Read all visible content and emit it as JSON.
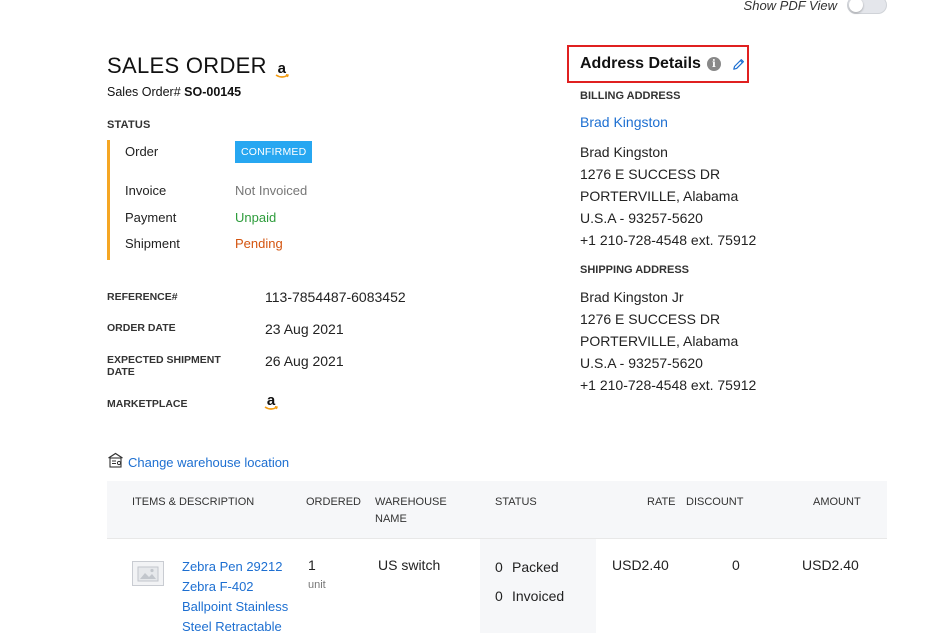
{
  "top": {
    "pdf_view_label": "Show PDF View"
  },
  "header": {
    "title": "SALES ORDER",
    "marketplace_logo_text": "a",
    "so_label": "Sales Order#",
    "so_number": "SO-00145"
  },
  "status": {
    "title": "STATUS",
    "rows": [
      {
        "label": "Order",
        "value": "CONFIRMED"
      },
      {
        "label": "Invoice",
        "value": "Not Invoiced"
      },
      {
        "label": "Payment",
        "value": "Unpaid"
      },
      {
        "label": "Shipment",
        "value": "Pending"
      }
    ],
    "colors": {
      "border": "#f5a623",
      "confirmed": "#27a7f1",
      "unpaid": "#2d9c3b",
      "pending": "#d4540f"
    }
  },
  "meta": {
    "reference_label": "REFERENCE#",
    "reference_value": "113-7854487-6083452",
    "order_date_label": "ORDER DATE",
    "order_date_value": "23 Aug 2021",
    "expected_shipment_label": "EXPECTED SHIPMENT DATE",
    "expected_shipment_value": "26 Aug 2021",
    "marketplace_label": "MARKETPLACE",
    "marketplace_icon": "amazon-logo"
  },
  "address": {
    "header_title": "Address Details",
    "billing_label": "BILLING ADDRESS",
    "billing_contact_link": "Brad Kingston",
    "billing_lines": [
      "Brad Kingston",
      "1276 E SUCCESS DR",
      "PORTERVILLE, Alabama",
      "U.S.A - 93257-5620",
      "+1 210-728-4548 ext. 75912"
    ],
    "shipping_label": "SHIPPING ADDRESS",
    "shipping_lines": [
      "Brad Kingston Jr",
      "1276 E SUCCESS DR",
      "PORTERVILLE, Alabama",
      "U.S.A - 93257-5620",
      "+1 210-728-4548 ext. 75912"
    ],
    "highlight_color": "#e02020"
  },
  "warehouse": {
    "link_text": "Change warehouse location"
  },
  "table": {
    "headers": {
      "items": "ITEMS & DESCRIPTION",
      "ordered": "ORDERED",
      "warehouse_l1": "WAREHOUSE",
      "warehouse_l2": "NAME",
      "status": "STATUS",
      "rate": "RATE",
      "discount": "DISCOUNT",
      "amount": "AMOUNT"
    },
    "rows": [
      {
        "item_lines": [
          "Zebra Pen 29212",
          "Zebra F-402",
          "Ballpoint Stainless",
          "Steel Retractable"
        ],
        "ordered_qty": "1",
        "ordered_unit": "unit",
        "warehouse": "US switch",
        "packed_count": "0",
        "packed_label": "Packed",
        "invoiced_count": "0",
        "invoiced_label": "Invoiced",
        "rate": "USD2.40",
        "discount": "0",
        "amount": "USD2.40"
      }
    ]
  }
}
